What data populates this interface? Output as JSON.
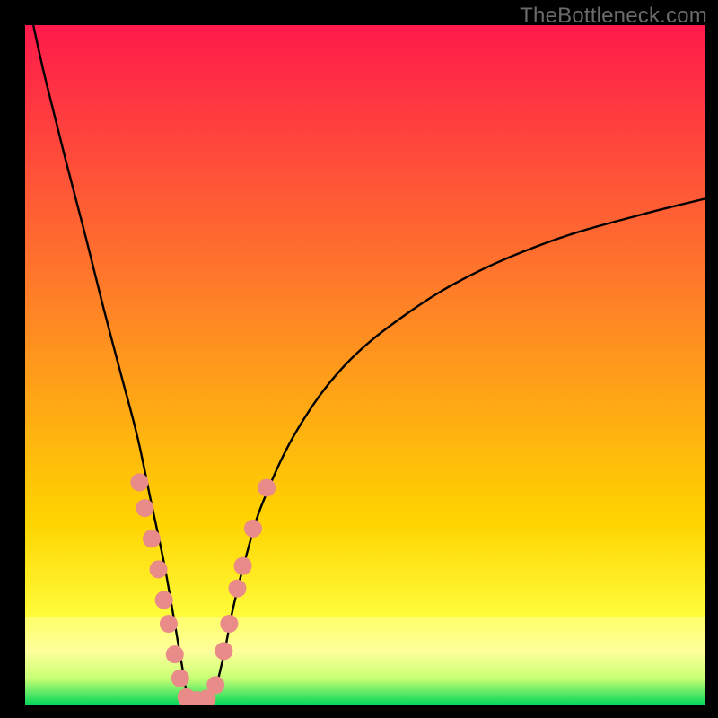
{
  "watermark": "TheBottleneck.com",
  "chart_data": {
    "type": "line",
    "title": "",
    "xlabel": "",
    "ylabel": "",
    "xlim": [
      0,
      1
    ],
    "ylim": [
      0,
      1
    ],
    "background_gradient": {
      "top_color": "#ff1a4b",
      "mid_top_color": "#ff7a2a",
      "mid_color": "#ffd400",
      "band_color": "#ffff9c",
      "bottom_color": "#00d65a"
    },
    "curve": {
      "description": "V-shaped bottleneck curve, percent mismatch vs. resource ratio",
      "minimum_x": 0.24,
      "points_left_branch": [
        {
          "x": 0.012,
          "y": 1.0
        },
        {
          "x": 0.03,
          "y": 0.92
        },
        {
          "x": 0.06,
          "y": 0.8
        },
        {
          "x": 0.09,
          "y": 0.685
        },
        {
          "x": 0.115,
          "y": 0.585
        },
        {
          "x": 0.14,
          "y": 0.49
        },
        {
          "x": 0.165,
          "y": 0.395
        },
        {
          "x": 0.185,
          "y": 0.3
        },
        {
          "x": 0.205,
          "y": 0.205
        },
        {
          "x": 0.22,
          "y": 0.12
        },
        {
          "x": 0.232,
          "y": 0.05
        },
        {
          "x": 0.24,
          "y": 0.0
        }
      ],
      "points_right_branch": [
        {
          "x": 0.24,
          "y": 0.0
        },
        {
          "x": 0.27,
          "y": 0.0
        },
        {
          "x": 0.29,
          "y": 0.065
        },
        {
          "x": 0.305,
          "y": 0.14
        },
        {
          "x": 0.325,
          "y": 0.22
        },
        {
          "x": 0.35,
          "y": 0.3
        },
        {
          "x": 0.4,
          "y": 0.405
        },
        {
          "x": 0.47,
          "y": 0.5
        },
        {
          "x": 0.56,
          "y": 0.575
        },
        {
          "x": 0.66,
          "y": 0.635
        },
        {
          "x": 0.78,
          "y": 0.685
        },
        {
          "x": 0.9,
          "y": 0.72
        },
        {
          "x": 1.0,
          "y": 0.745
        }
      ]
    },
    "dot_markers": {
      "color": "#e98b88",
      "points": [
        {
          "x": 0.168,
          "y": 0.328
        },
        {
          "x": 0.176,
          "y": 0.29
        },
        {
          "x": 0.186,
          "y": 0.245
        },
        {
          "x": 0.196,
          "y": 0.2
        },
        {
          "x": 0.204,
          "y": 0.155
        },
        {
          "x": 0.211,
          "y": 0.12
        },
        {
          "x": 0.22,
          "y": 0.075
        },
        {
          "x": 0.228,
          "y": 0.04
        },
        {
          "x": 0.237,
          "y": 0.012
        },
        {
          "x": 0.252,
          "y": 0.008
        },
        {
          "x": 0.267,
          "y": 0.01
        },
        {
          "x": 0.28,
          "y": 0.03
        },
        {
          "x": 0.292,
          "y": 0.08
        },
        {
          "x": 0.3,
          "y": 0.12
        },
        {
          "x": 0.312,
          "y": 0.172
        },
        {
          "x": 0.32,
          "y": 0.205
        },
        {
          "x": 0.335,
          "y": 0.26
        },
        {
          "x": 0.355,
          "y": 0.32
        }
      ]
    }
  }
}
